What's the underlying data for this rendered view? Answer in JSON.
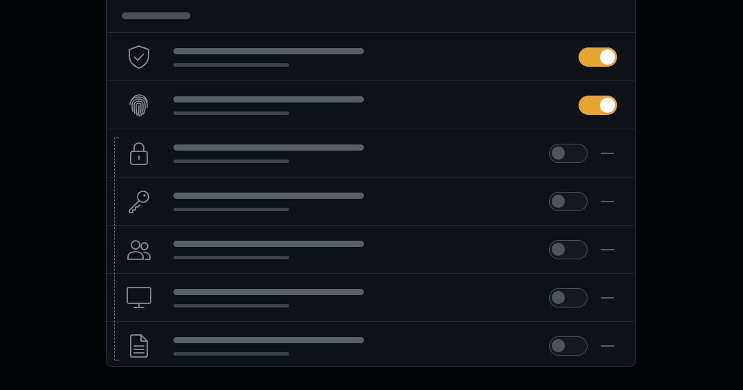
{
  "panel": {
    "header": {
      "title": ""
    }
  },
  "rows": [
    {
      "icon": "shield-check-icon",
      "title": "",
      "subtitle": "",
      "enabled": true
    },
    {
      "icon": "fingerprint-icon",
      "title": "",
      "subtitle": "",
      "enabled": true
    },
    {
      "icon": "lock-icon",
      "title": "",
      "subtitle": "",
      "enabled": false
    },
    {
      "icon": "key-icon",
      "title": "",
      "subtitle": "",
      "enabled": false
    },
    {
      "icon": "users-icon",
      "title": "",
      "subtitle": "",
      "enabled": false
    },
    {
      "icon": "monitor-icon",
      "title": "",
      "subtitle": "",
      "enabled": false
    },
    {
      "icon": "document-icon",
      "title": "",
      "subtitle": "",
      "enabled": false
    }
  ],
  "colors": {
    "background": "#030406",
    "panel": "#0e1117",
    "accent": "#e8a531",
    "toggle_off_border": "#4a4e56",
    "skeleton": "#5a5e66",
    "icon_stroke": "#8a8e96"
  }
}
